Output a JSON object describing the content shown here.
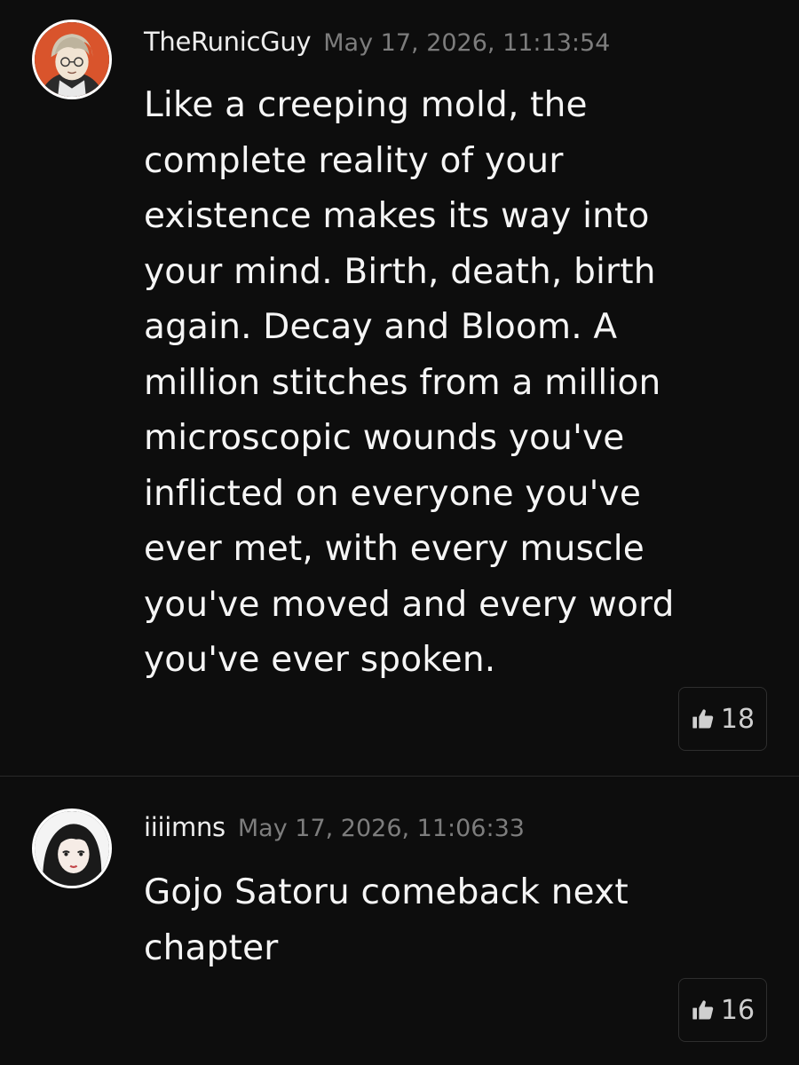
{
  "comments": [
    {
      "username": "TheRunicGuy",
      "timestamp": "May 17, 2026, 11:13:54",
      "avatar_icon": "anime-character-avatar",
      "text": "Like a creeping mold, the\ncomplete reality of your\nexistence makes its way into\nyour mind. Birth, death, birth\nagain. Decay and Bloom. A\nmillion stitches from a million\nmicroscopic wounds you've\ninflicted on everyone you've\never met, with every muscle\nyou've moved and every word\nyou've ever spoken.",
      "likes": "18",
      "like_icon": "thumbs-up-icon"
    },
    {
      "username": "iiiimns",
      "timestamp": "May 17, 2026, 11:06:33",
      "avatar_icon": "anime-character-avatar",
      "text": "Gojo Satoru comeback next\nchapter",
      "likes": "16",
      "like_icon": "thumbs-up-icon"
    }
  ],
  "colors": {
    "background": "#0d0d0d",
    "text": "#f5f5f5",
    "timestamp": "#7d7d7d",
    "divider": "#2a2a2a"
  }
}
